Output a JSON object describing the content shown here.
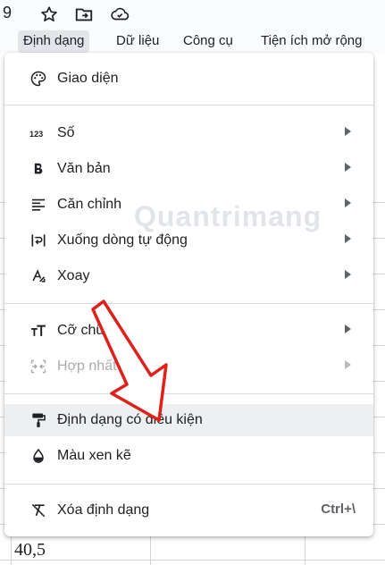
{
  "titlebar": {
    "leading_text": "9",
    "icons": [
      "star-icon",
      "move-to-folder-icon",
      "cloud-status-icon"
    ]
  },
  "menubar": {
    "items": [
      "Định dạng",
      "Dữ liệu",
      "Công cụ",
      "Tiện ích mở rộng"
    ],
    "active": "Định dạng"
  },
  "sheet": {
    "visible_cells": [
      "40,5"
    ]
  },
  "format_menu": {
    "items": [
      {
        "label": "Giao diện",
        "icon": "palette-icon",
        "submenu": false
      },
      {
        "label": "Số",
        "icon": "number-123-icon",
        "submenu": true
      },
      {
        "label": "Văn bản",
        "icon": "bold-icon",
        "submenu": true
      },
      {
        "label": "Căn chỉnh",
        "icon": "align-left-icon",
        "submenu": true
      },
      {
        "label": "Xuống dòng tự động",
        "icon": "text-wrap-icon",
        "submenu": true
      },
      {
        "label": "Xoay",
        "icon": "text-rotation-icon",
        "submenu": true
      },
      {
        "label": "Cỡ chữ",
        "icon": "font-size-icon",
        "submenu": true
      },
      {
        "label": "Hợp nhất ô",
        "icon": "merge-cells-icon",
        "submenu": true,
        "disabled": true
      },
      {
        "label": "Định dạng có điều kiện",
        "icon": "paint-format-icon",
        "submenu": false,
        "highlighted": true
      },
      {
        "label": "Màu xen kẽ",
        "icon": "color-drop-icon",
        "submenu": false
      },
      {
        "label": "Xóa định dạng",
        "icon": "clear-format-icon",
        "submenu": false,
        "shortcut": "Ctrl+\\"
      }
    ]
  },
  "watermark": "Quantrimang",
  "colors": {
    "menu_text": "#202124",
    "disabled_text": "#a8abae",
    "highlight_bg": "#eeeff1",
    "annotation_arrow": "#e0211b"
  }
}
